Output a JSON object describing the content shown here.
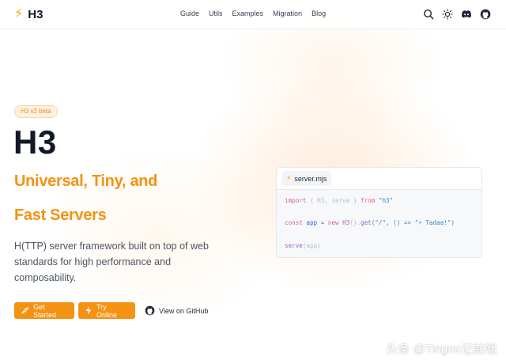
{
  "header": {
    "logo_text": "H3",
    "nav": [
      "Guide",
      "Utils",
      "Examples",
      "Migration",
      "Blog"
    ],
    "icons": [
      "search-icon",
      "sun-icon",
      "discord-icon",
      "github-icon"
    ]
  },
  "hero": {
    "badge": "H3 v2 beta",
    "title": "H3",
    "subtitle_line1": "Universal, Tiny, and",
    "subtitle_line2": "Fast Servers",
    "description": "H(TTP) server framework built on top of web standards for high performance and composability.",
    "buttons": {
      "get_started": "Get Started",
      "try_online": "Try Online",
      "github": "View on GitHub"
    }
  },
  "code_card": {
    "tab_label": "server.mjs",
    "line1": {
      "k1": "import",
      "b": " { H3, serve } ",
      "k2": "from",
      "s": " \"h3\""
    },
    "line2": {
      "k": "const",
      "a": " app ",
      "eq": "=",
      "n": " new",
      "c": " H3",
      "p": "().",
      "g": "get",
      "args": "(\"/\", () => \"⚡ Tadaa!\")"
    },
    "line3": {
      "f": "serve",
      "args": "(app)"
    }
  },
  "watermark": "头条 @Tingno记前端",
  "colors": {
    "accent": "#f59211",
    "badge_bg": "#fff1e2"
  }
}
